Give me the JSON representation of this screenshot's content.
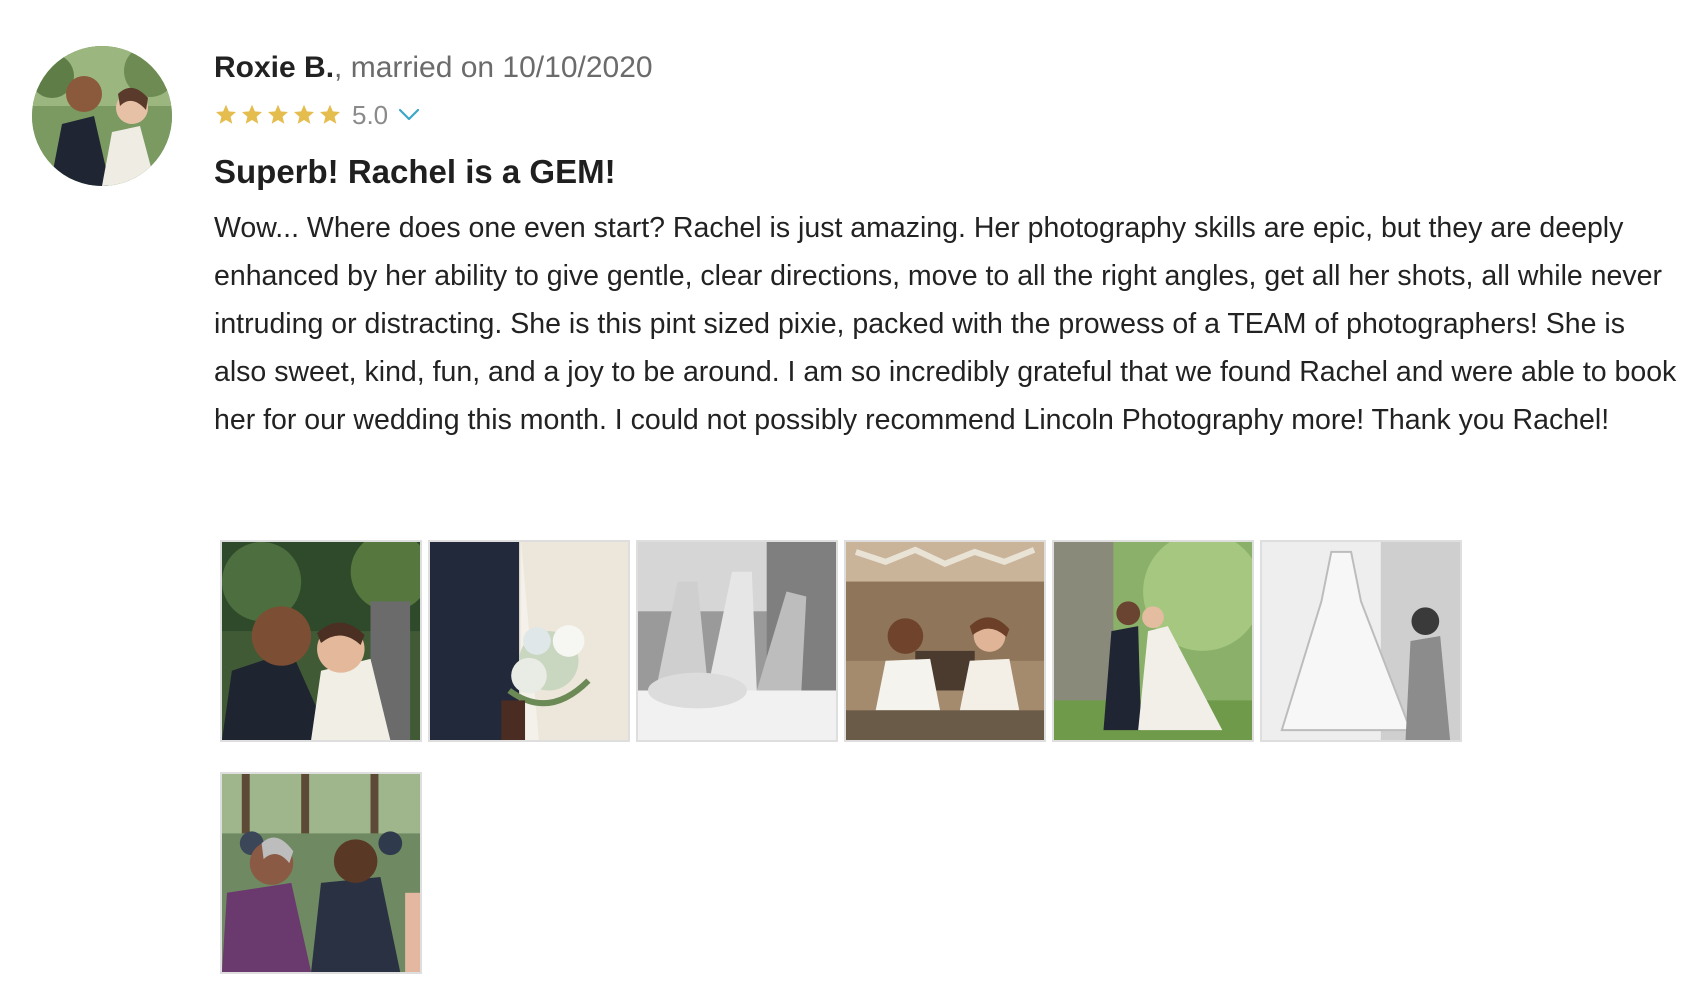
{
  "review": {
    "author": {
      "name": "Roxie B.",
      "married_text": ", married on 10/10/2020",
      "avatar_icon": "couple-photo"
    },
    "rating": {
      "stars": 5,
      "max_stars": 5,
      "value": "5.0",
      "star_color": "#e5bd4f",
      "chevron_color": "#3aa6c8"
    },
    "title": "Superb! Rachel is a GEM!",
    "body": "Wow... Where does one even start? Rachel is just amazing. Her photography skills are epic, but they are deeply enhanced by her ability to give gentle, clear directions, move to all the right angles, get all her shots, all while never intruding or distracting. She is this pint sized pixie, packed with the prowess of a TEAM of photographers! She is also sweet, kind, fun, and a joy to be around. I am so incredibly grateful that we found Rachel and were able to book her for our wedding this month. I could not possibly recommend Lincoln Photography more! Thank you Rachel!",
    "photos": [
      {
        "subject": "couple-embrace-garden"
      },
      {
        "subject": "bouquet-closeup"
      },
      {
        "subject": "bridal-party-toast-bw"
      },
      {
        "subject": "couple-at-head-table"
      },
      {
        "subject": "couple-kiss-outdoors"
      },
      {
        "subject": "wedding-dress-bw"
      },
      {
        "subject": "guests-ceremony"
      }
    ]
  }
}
